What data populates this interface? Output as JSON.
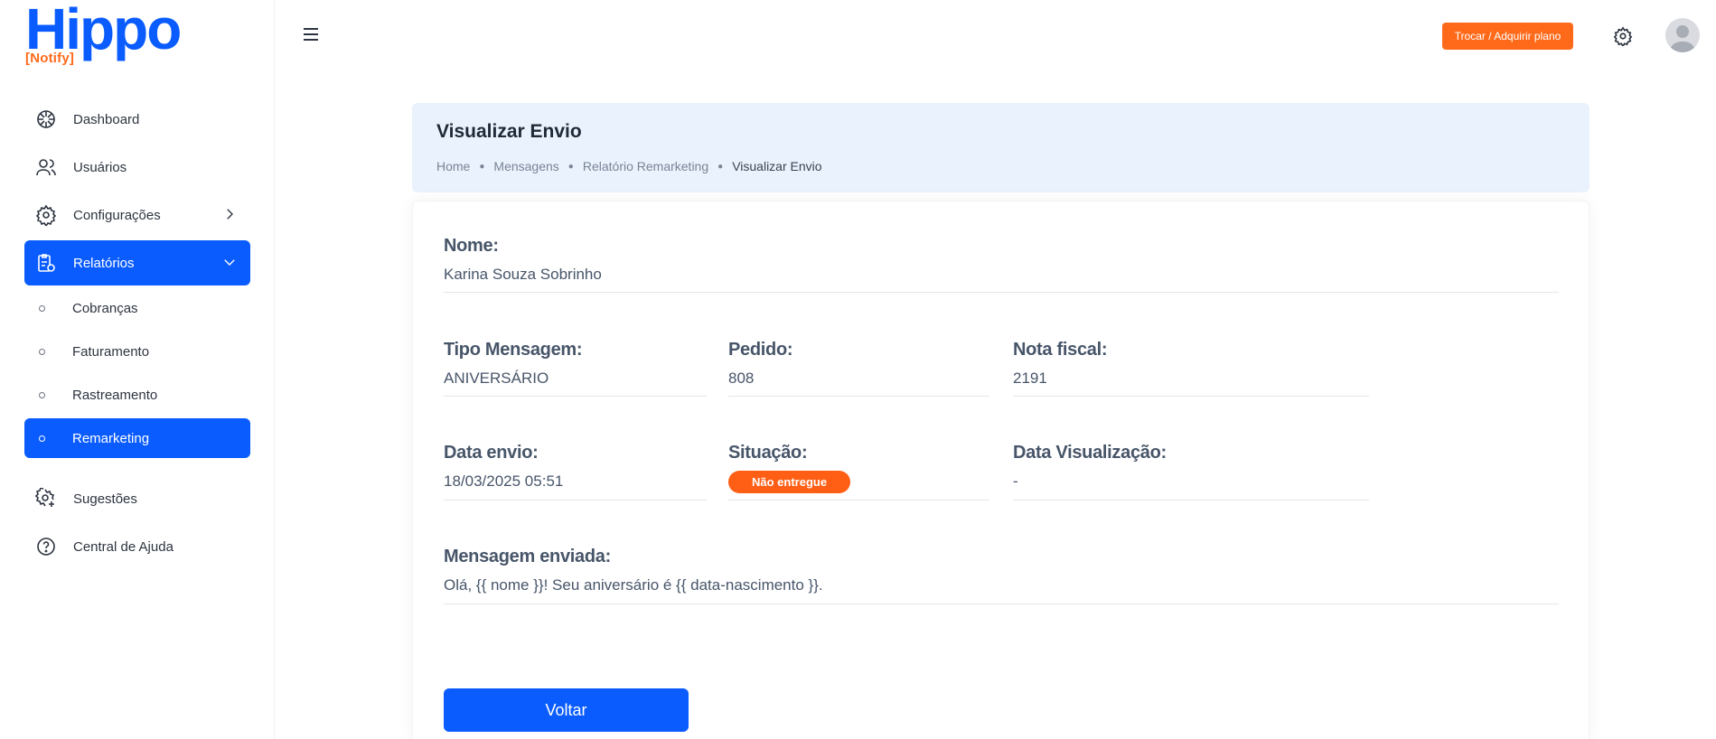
{
  "brand": {
    "name": "Hippo",
    "sub": "[Notify]"
  },
  "sidebar": {
    "items": [
      {
        "label": "Dashboard",
        "icon": "dashboard-icon"
      },
      {
        "label": "Usuários",
        "icon": "users-icon"
      },
      {
        "label": "Configurações",
        "icon": "gear-icon"
      },
      {
        "label": "Relatórios",
        "icon": "report-icon"
      }
    ],
    "sub_items": [
      {
        "label": "Cobranças"
      },
      {
        "label": "Faturamento"
      },
      {
        "label": "Rastreamento"
      },
      {
        "label": "Remarketing"
      }
    ],
    "bottom_items": [
      {
        "label": "Sugestões",
        "icon": "suggestion-gear-icon"
      },
      {
        "label": "Central de Ajuda",
        "icon": "help-icon"
      }
    ]
  },
  "topbar": {
    "upgrade_label": "Trocar / Adquirir plano"
  },
  "header": {
    "title": "Visualizar Envio",
    "breadcrumb": [
      "Home",
      "Mensagens",
      "Relatório Remarketing",
      "Visualizar Envio"
    ]
  },
  "details": {
    "nome": {
      "label": "Nome:",
      "value": "Karina Souza Sobrinho"
    },
    "tipo": {
      "label": "Tipo Mensagem:",
      "value": "ANIVERSÁRIO"
    },
    "pedido": {
      "label": "Pedido:",
      "value": "808"
    },
    "nota": {
      "label": "Nota fiscal:",
      "value": "2191"
    },
    "data_envio": {
      "label": "Data envio:",
      "value": "18/03/2025 05:51"
    },
    "situacao": {
      "label": "Situação:",
      "value": "Não entregue"
    },
    "data_visualizacao": {
      "label": "Data Visualização:",
      "value": "-"
    },
    "mensagem": {
      "label": "Mensagem enviada:",
      "value": "Olá, {{ nome }}! Seu aniversário é {{ data-nascimento }}."
    }
  },
  "actions": {
    "back_label": "Voltar"
  },
  "colors": {
    "primary": "#0a5cff",
    "accent": "#ff6a1a",
    "header_bg": "#e9f2fd"
  }
}
